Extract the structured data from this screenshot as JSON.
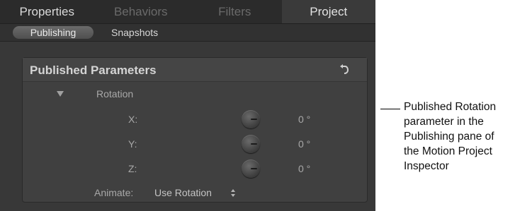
{
  "tabs": [
    "Properties",
    "Behaviors",
    "Filters",
    "Project"
  ],
  "subtabs": {
    "active": "Publishing",
    "other": "Snapshots"
  },
  "panel": {
    "title": "Published Parameters",
    "group_label": "Rotation",
    "rows": [
      {
        "label": "X:",
        "value": "0 °"
      },
      {
        "label": "Y:",
        "value": "0 °"
      },
      {
        "label": "Z:",
        "value": "0 °"
      }
    ],
    "animate_label": "Animate:",
    "animate_value": "Use Rotation"
  },
  "caption": [
    "Published Rotation",
    "parameter in the",
    "Publishing pane of",
    "the Motion Project",
    "Inspector"
  ],
  "icons": {
    "reset": "reset-arrow-icon",
    "disclosure": "disclosure-triangle-icon",
    "stepper": "up-down-stepper-icon",
    "dial": "rotation-dial-icon"
  }
}
